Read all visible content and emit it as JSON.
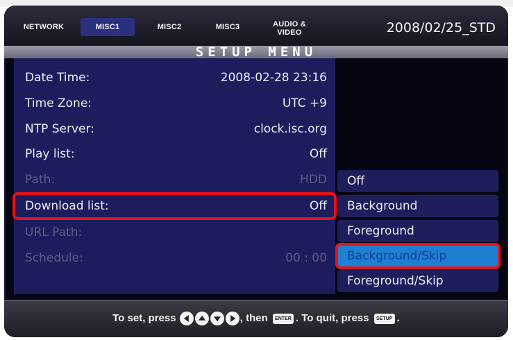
{
  "tabs": [
    {
      "label": "NETWORK",
      "active": false
    },
    {
      "label": "MISC1",
      "active": true
    },
    {
      "label": "MISC2",
      "active": false
    },
    {
      "label": "MISC3",
      "active": false
    },
    {
      "label": "AUDIO & VIDEO",
      "active": false
    }
  ],
  "version": "2008/02/25_STD",
  "title": "SETUP MENU",
  "settings": [
    {
      "label": "Date Time:",
      "value": "2008-02-28 23:16",
      "enabled": true
    },
    {
      "label": "Time Zone:",
      "value": "UTC +9",
      "enabled": true
    },
    {
      "label": "NTP Server:",
      "value": "clock.isc.org",
      "enabled": true
    },
    {
      "label": "Play list:",
      "value": "Off",
      "enabled": true
    },
    {
      "label": "Path:",
      "value": "HDD",
      "enabled": false
    },
    {
      "label": "Download list:",
      "value": "Off",
      "enabled": true,
      "highlighted": true
    },
    {
      "label": "URL Path:",
      "value": "",
      "enabled": false
    },
    {
      "label": "Schedule:",
      "value": "00 : 00",
      "enabled": false
    }
  ],
  "dropdown_options": [
    "Off",
    "Background",
    "Foreground",
    "Background/Skip",
    "Foreground/Skip"
  ],
  "dropdown_selected": "Background/Skip",
  "help": {
    "prefix": "To set, press",
    "middle": ", then",
    "enter_key": "ENTER",
    "quit_text": ". To quit, press",
    "setup_key": "SETUP",
    "suffix": "."
  },
  "colors": {
    "panel": "#1d1d5e",
    "active_tab": "#2a2f7e",
    "selection": "#1f7fd0",
    "highlight_border": "#e8101a"
  }
}
